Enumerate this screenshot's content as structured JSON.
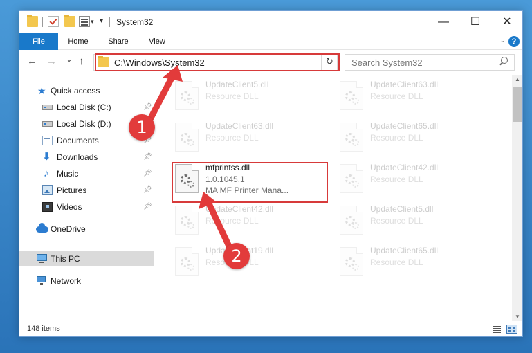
{
  "window": {
    "title": "System32",
    "controls": {
      "minimize": "—",
      "maximize": "☐",
      "close": "✕"
    }
  },
  "ribbon": {
    "tabs": [
      {
        "label": "File"
      },
      {
        "label": "Home"
      },
      {
        "label": "Share"
      },
      {
        "label": "View"
      }
    ],
    "help": "?"
  },
  "nav": {
    "back": "←",
    "forward": "→",
    "recent": "⌄",
    "up": "↑",
    "address": "C:\\Windows\\System32",
    "address_dropdown": "⌄",
    "refresh": "↻",
    "search_placeholder": "Search System32"
  },
  "sidebar": {
    "items": [
      {
        "label": "Quick access",
        "icon": "star-icon",
        "pinned": false
      },
      {
        "label": "Local Disk (C:)",
        "icon": "drive-icon",
        "pinned": true
      },
      {
        "label": "Local Disk (D:)",
        "icon": "drive-icon",
        "pinned": false
      },
      {
        "label": "Documents",
        "icon": "documents-icon",
        "pinned": true
      },
      {
        "label": "Downloads",
        "icon": "downloads-icon",
        "pinned": true
      },
      {
        "label": "Music",
        "icon": "music-icon",
        "pinned": true
      },
      {
        "label": "Pictures",
        "icon": "pictures-icon",
        "pinned": true
      },
      {
        "label": "Videos",
        "icon": "videos-icon",
        "pinned": true
      },
      {
        "label": "OneDrive",
        "icon": "onedrive-icon",
        "pinned": false
      },
      {
        "label": "This PC",
        "icon": "this-pc-icon",
        "pinned": false,
        "selected": true
      },
      {
        "label": "Network",
        "icon": "network-icon",
        "pinned": false
      }
    ]
  },
  "files": {
    "left": [
      {
        "name": "UpdateClient5.dll",
        "desc": "Resource DLL"
      },
      {
        "name": "UpdateClient63.dll",
        "desc": "Resource DLL"
      },
      {
        "name": "mfprintss.dll",
        "version": "1.0.1045.1",
        "desc": "MA MF Printer Mana...",
        "highlighted": true
      },
      {
        "name": "UpdateClient42.dll",
        "desc": "Resource DLL"
      },
      {
        "name": "UpdateClient19.dll",
        "desc": "Resource DLL"
      }
    ],
    "right": [
      {
        "name": "UpdateClient63.dll",
        "desc": "Resource DLL"
      },
      {
        "name": "UpdateClient65.dll",
        "desc": "Resource DLL"
      },
      {
        "name": "UpdateClient42.dll",
        "desc": "Resource DLL"
      },
      {
        "name": "UpdateClient5.dll",
        "desc": "Resource DLL"
      },
      {
        "name": "UpdateClient65.dll",
        "desc": "Resource DLL"
      }
    ]
  },
  "status": {
    "item_count": "148 items"
  },
  "annotations": {
    "step1": "1",
    "step2": "2"
  },
  "colors": {
    "accent": "#1979ca",
    "highlight": "#d73a3a",
    "desktop": "#2a73b8"
  }
}
